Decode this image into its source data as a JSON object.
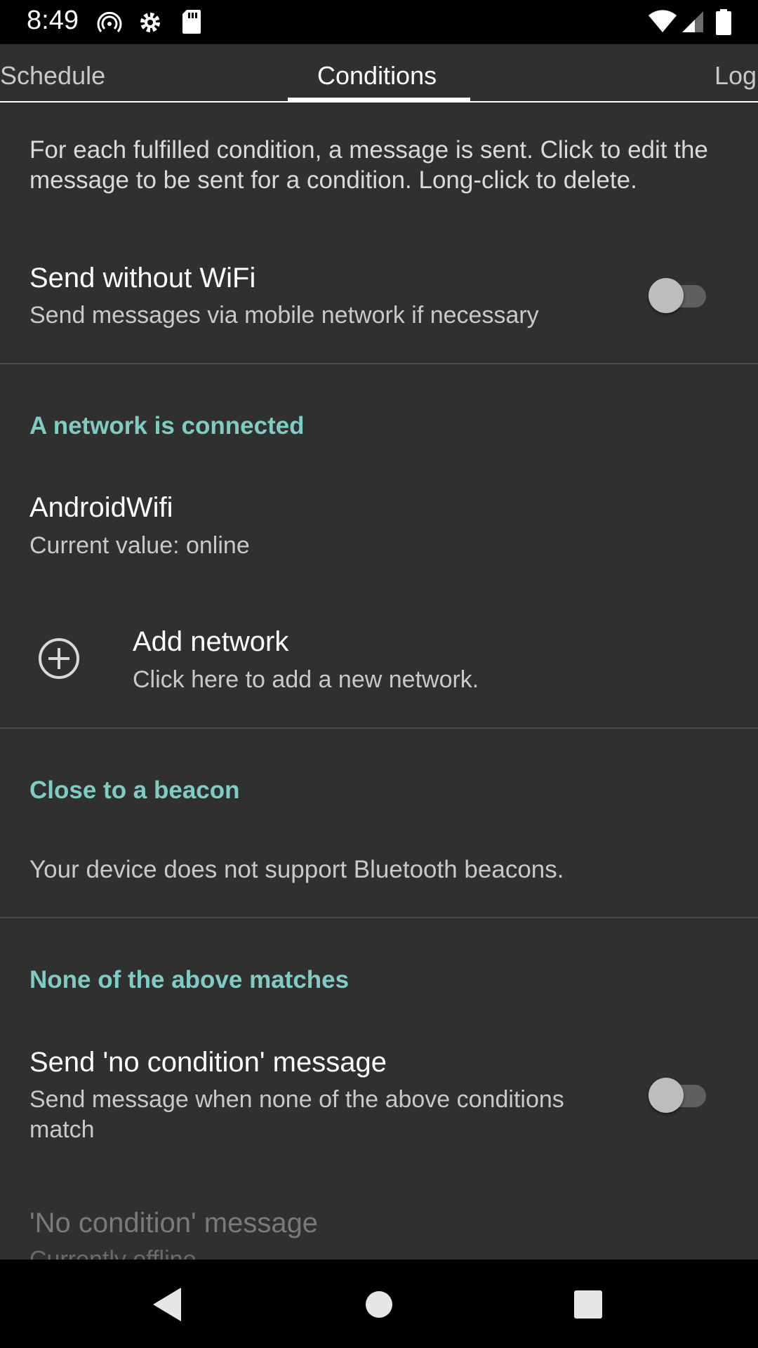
{
  "status_bar": {
    "time": "8:49",
    "left_icons": [
      "hotspot-icon",
      "gear-icon",
      "sd-card-icon"
    ],
    "right_icons": [
      "wifi-icon",
      "cell-signal-icon",
      "battery-icon"
    ]
  },
  "tabs": [
    {
      "label": "Schedule",
      "selected": false
    },
    {
      "label": "Conditions",
      "selected": true
    },
    {
      "label": "Log",
      "selected": false
    }
  ],
  "intro_text": "For each fulfilled condition, a message is sent. Click to edit the message to be sent for a condition. Long-click to delete.",
  "send_without_wifi": {
    "title": "Send without WiFi",
    "subtitle": "Send messages via mobile network if necessary",
    "enabled": false
  },
  "section_network": {
    "header": "A network is connected",
    "items": [
      {
        "title": "AndroidWifi",
        "subtitle": "Current value: online"
      }
    ],
    "add": {
      "title": "Add network",
      "subtitle": "Click here to add a new network.",
      "icon": "add-circle-icon"
    }
  },
  "section_beacon": {
    "header": "Close to a beacon",
    "message": "Your device does not support Bluetooth beacons."
  },
  "section_none": {
    "header": "None of the above matches",
    "no_condition": {
      "title": "Send 'no condition' message",
      "subtitle": "Send message when none of the above conditions match",
      "enabled": false
    },
    "no_condition_message": {
      "title": "'No condition' message",
      "subtitle": "Currently offline"
    }
  },
  "colors": {
    "background": "#303030",
    "accent": "#80cbc4",
    "bars": "#000000"
  },
  "nav_bar": [
    "back-icon",
    "home-icon",
    "recents-icon"
  ]
}
